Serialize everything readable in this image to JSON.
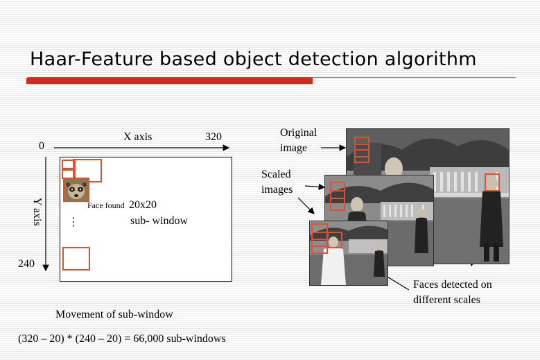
{
  "slide": {
    "title": "Haar-Feature based object detection algorithm",
    "colors": {
      "accent": "#cf2a1a",
      "box": "#d9532f"
    }
  },
  "left_diagram": {
    "origin_label": "0",
    "x_axis_label": "X axis",
    "x_max_label": "320",
    "y_axis_label": "Y axis",
    "y_max_label": "240",
    "face_found_label": "Face found",
    "window_size_label": "20x20",
    "window_name_label": "sub- window",
    "ellipsis": "⋮",
    "caption": "Movement of sub-window",
    "formula": "(320 – 20) * (240 – 20) = 66,000 sub-windows"
  },
  "right_diagram": {
    "original_label_line1": "Original",
    "original_label_line2": "image",
    "scaled_label_line1": "Scaled",
    "scaled_label_line2": "images",
    "faces_label_line1": "Faces detected on",
    "faces_label_line2": "different scales"
  }
}
